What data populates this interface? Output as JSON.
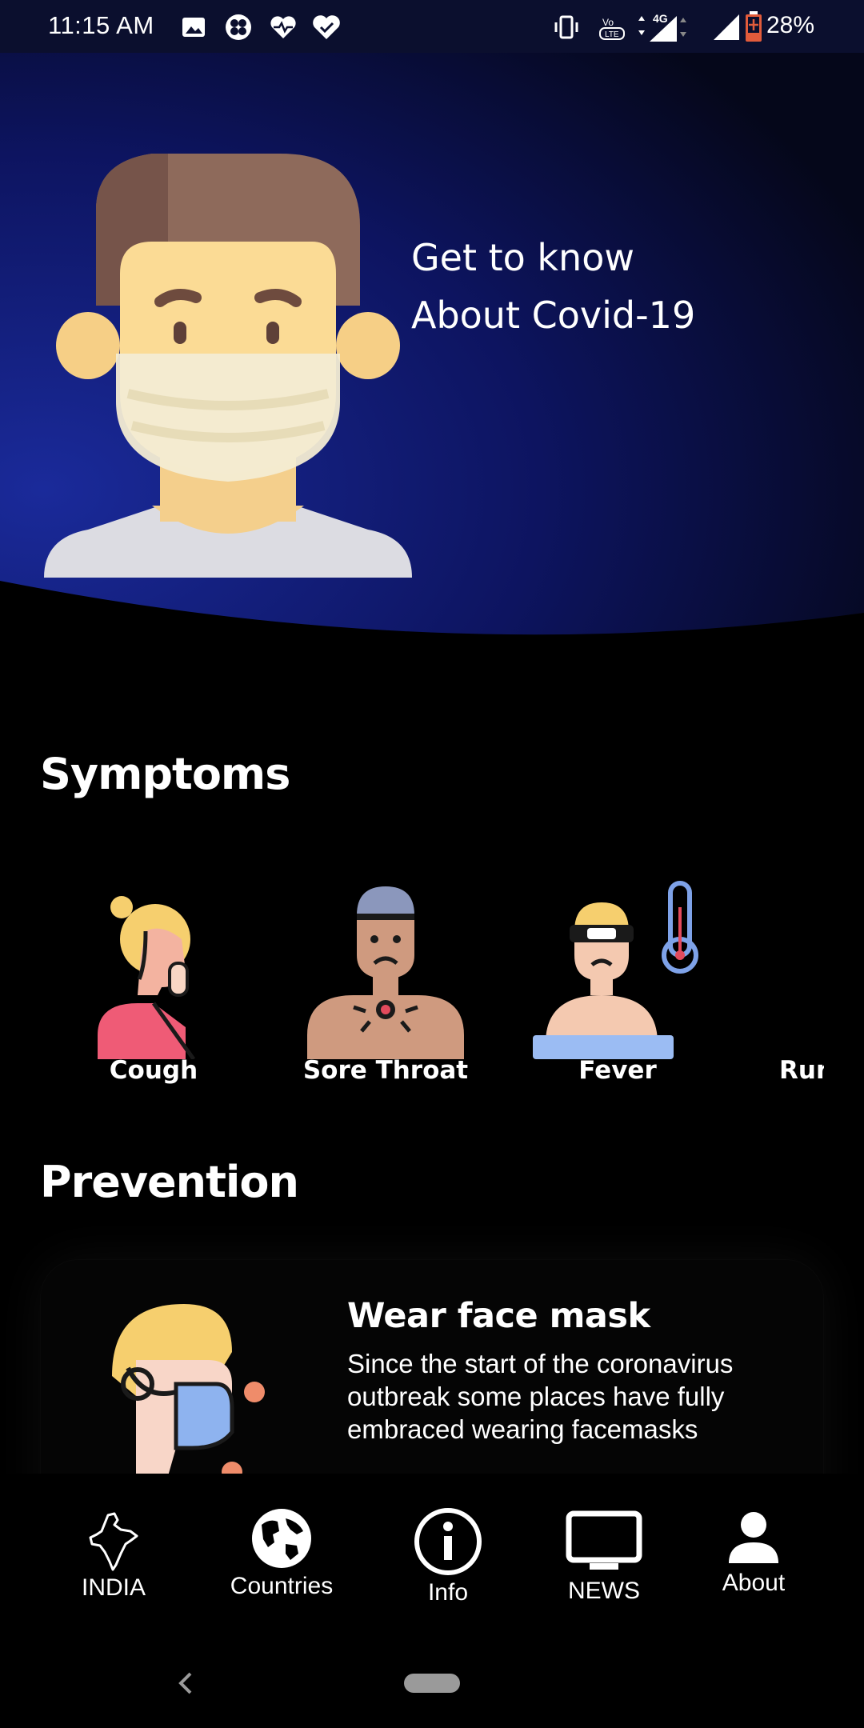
{
  "status_bar": {
    "time": "11:15 AM",
    "battery": "28%",
    "icons": [
      "image-icon",
      "fan-icon",
      "heartbeat-icon",
      "heart-check-icon",
      "vibrate-icon",
      "volte-icon",
      "4g-signal-icon",
      "signal-icon",
      "battery-icon"
    ]
  },
  "hero": {
    "title_line1": "Get to know",
    "title_line2": "About Covid-19",
    "gradient_from": "#1a2a9a",
    "gradient_to": "#05071a"
  },
  "symptoms": {
    "title": "Symptoms",
    "items": [
      {
        "label": "Cough",
        "icon": "cough-person-icon"
      },
      {
        "label": "Sore Throat",
        "icon": "sore-throat-person-icon"
      },
      {
        "label": "Fever",
        "icon": "fever-person-icon"
      },
      {
        "label": "Run",
        "icon": "runny-nose-person-icon"
      }
    ]
  },
  "prevention": {
    "title": "Prevention",
    "card": {
      "title": "Wear face mask",
      "text": "Since the start of the coronavirus outbreak some places have fully embraced wearing facemasks",
      "icon": "masked-person-icon"
    }
  },
  "bottom_nav": {
    "items": [
      {
        "label": "INDIA",
        "icon": "india-map-icon"
      },
      {
        "label": "Countries",
        "icon": "globe-icon"
      },
      {
        "label": "Info",
        "icon": "info-icon"
      },
      {
        "label": "NEWS",
        "icon": "tv-icon"
      },
      {
        "label": "About",
        "icon": "person-icon"
      }
    ]
  }
}
